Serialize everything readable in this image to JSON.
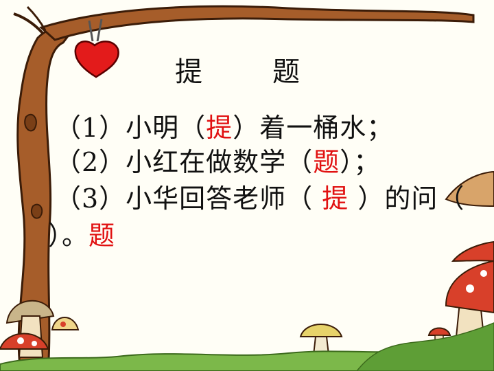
{
  "title": {
    "left": "提",
    "right": "题"
  },
  "lines": [
    {
      "prefix": "（1）小明（",
      "answer": "提",
      "suffix": "）着一桶水；"
    },
    {
      "prefix": "（2）小红在做数学（",
      "answer": "题",
      "suffix": "）；"
    },
    {
      "prefix": "（3）小华回答老师（ ",
      "answer": "提",
      "suffix": " ）的问（"
    }
  ],
  "line4": {
    "prefix": "）。",
    "answer": "题"
  },
  "colors": {
    "answer": "#e11111",
    "background": "#fffef6",
    "tree": "#8b4a1e",
    "heart": "#e31b1b",
    "mushroom": "#d8402a"
  }
}
